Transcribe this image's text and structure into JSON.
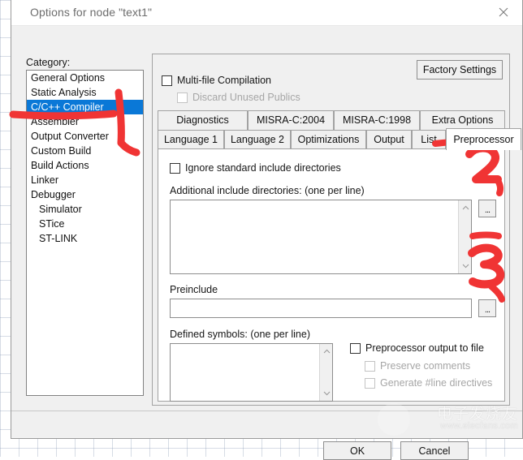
{
  "window": {
    "title": "Options for node \"text1\"",
    "close_icon": "close-icon"
  },
  "sidebar": {
    "label": "Category:",
    "items": [
      {
        "label": "General Options",
        "selected": false,
        "indent": false
      },
      {
        "label": "Static Analysis",
        "selected": false,
        "indent": false
      },
      {
        "label": "C/C++ Compiler",
        "selected": true,
        "indent": false
      },
      {
        "label": "Assembler",
        "selected": false,
        "indent": false
      },
      {
        "label": "Output Converter",
        "selected": false,
        "indent": false
      },
      {
        "label": "Custom Build",
        "selected": false,
        "indent": false
      },
      {
        "label": "Build Actions",
        "selected": false,
        "indent": false
      },
      {
        "label": "Linker",
        "selected": false,
        "indent": false
      },
      {
        "label": "Debugger",
        "selected": false,
        "indent": false
      },
      {
        "label": "Simulator",
        "selected": false,
        "indent": true
      },
      {
        "label": "STice",
        "selected": false,
        "indent": true
      },
      {
        "label": "ST-LINK",
        "selected": false,
        "indent": true
      }
    ]
  },
  "panel": {
    "factory_settings_label": "Factory Settings",
    "multifile_compilation": {
      "label": "Multi-file Compilation",
      "checked": false,
      "enabled": true
    },
    "discard_unused_publics": {
      "label": "Discard Unused Publics",
      "checked": false,
      "enabled": false
    },
    "tabs_row1": [
      {
        "label": "Diagnostics",
        "active": false
      },
      {
        "label": "MISRA-C:2004",
        "active": false
      },
      {
        "label": "MISRA-C:1998",
        "active": false
      },
      {
        "label": "Extra Options",
        "active": false
      }
    ],
    "tabs_row2": [
      {
        "label": "Language 1",
        "active": false
      },
      {
        "label": "Language 2",
        "active": false
      },
      {
        "label": "Optimizations",
        "active": false
      },
      {
        "label": "Output",
        "active": false
      },
      {
        "label": "List",
        "active": false
      },
      {
        "label": "Preprocessor",
        "active": true
      }
    ]
  },
  "preprocessor": {
    "ignore_standard_include": {
      "label": "Ignore standard include directories",
      "checked": false
    },
    "additional_include_label": "Additional include directories: (one per line)",
    "additional_include_value": "",
    "additional_include_browse": "...",
    "preinclude_label": "Preinclude",
    "preinclude_value": "",
    "preinclude_placeholder": "",
    "preinclude_browse": "...",
    "defined_symbols_label": "Defined symbols: (one per line)",
    "defined_symbols_value": "",
    "preprocessor_output_to_file": {
      "label": "Preprocessor output to file",
      "checked": false,
      "enabled": true
    },
    "preserve_comments": {
      "label": "Preserve comments",
      "checked": false,
      "enabled": false
    },
    "generate_line_directives": {
      "label": "Generate #line directives",
      "checked": false,
      "enabled": false
    }
  },
  "footer": {
    "ok_label": "OK",
    "cancel_label": "Cancel"
  },
  "annotations": {
    "color": "#f03434",
    "marks": [
      {
        "name": "step-1",
        "text": "1"
      },
      {
        "name": "step-2",
        "text": "2"
      },
      {
        "name": "step-3",
        "text": "3"
      }
    ]
  },
  "watermark": {
    "brand_cn": "电子发烧友",
    "url": "www.elecfans.com"
  }
}
